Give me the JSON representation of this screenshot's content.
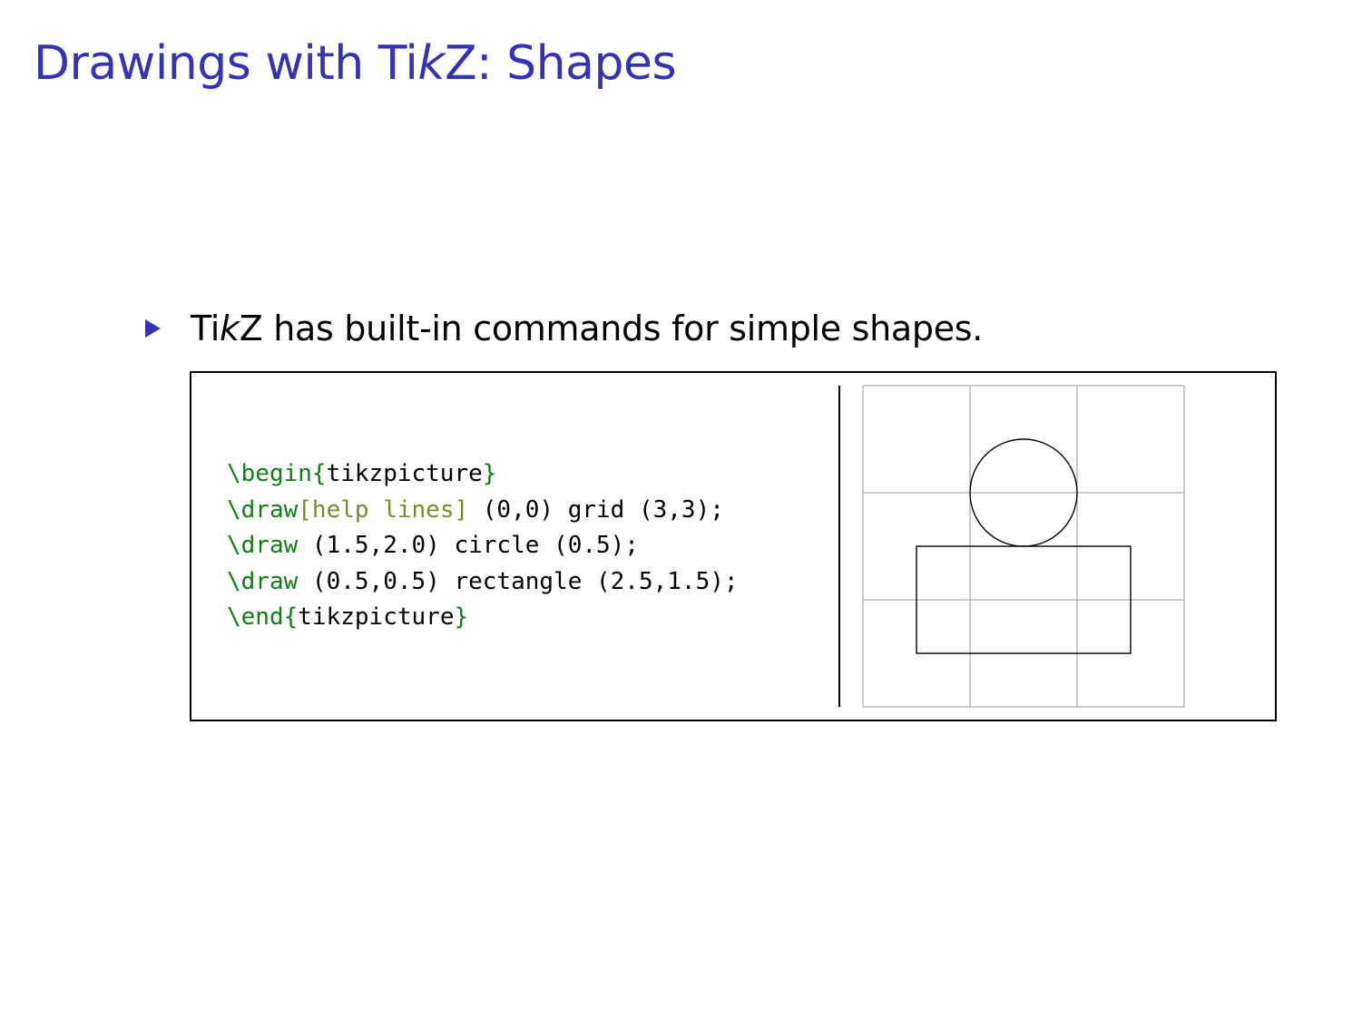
{
  "slide": {
    "title_pre": "Drawings with Ti",
    "title_italic": "k",
    "title_post": "Z: Shapes"
  },
  "bullet": {
    "text_pre": "Ti",
    "text_italic": "k",
    "text_post": "Z has built-in commands for simple shapes."
  },
  "code": {
    "line1": {
      "cmd": "\\begin",
      "open": "{",
      "arg": "tikzpicture",
      "close": "}"
    },
    "line2": {
      "cmd": "\\draw",
      "opt": "[help lines]",
      "rest": " (0,0) grid (3,3);"
    },
    "line3": {
      "cmd": "\\draw",
      "rest": " (1.5,2.0) circle (0.5);"
    },
    "line4": {
      "cmd": "\\draw",
      "rest": " (0.5,0.5) rectangle (2.5,1.5);"
    },
    "line5": {
      "cmd": "\\end",
      "open": "{",
      "arg": "tikzpicture",
      "close": "}"
    }
  },
  "figure": {
    "grid": {
      "from": [
        0,
        0
      ],
      "to": [
        3,
        3
      ],
      "step": 1,
      "color": "#999999"
    },
    "circle": {
      "center": [
        1.5,
        2.0
      ],
      "radius": 0.5,
      "color": "#000000"
    },
    "rectangle": {
      "from": [
        0.5,
        0.5
      ],
      "to": [
        2.5,
        1.5
      ],
      "color": "#000000"
    }
  },
  "colors": {
    "title": "#3333b3",
    "bullet_marker": "#3333b3",
    "code_keyword": "#0f7f12",
    "code_option": "#7a8a2a"
  }
}
